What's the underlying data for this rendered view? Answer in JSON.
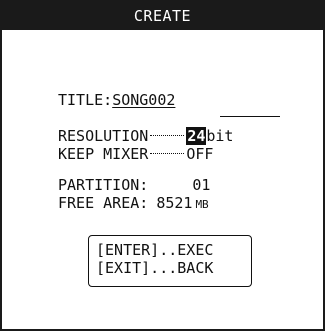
{
  "window": {
    "title": "CREATE"
  },
  "form": {
    "title_label": "TITLE:",
    "title_value": "SONG002",
    "resolution_label": "RESOLUTION",
    "resolution_value": "24",
    "resolution_unit": "bit",
    "keep_mixer_label": "KEEP MIXER",
    "keep_mixer_value": "OFF",
    "partition_label": "PARTITION:",
    "partition_value": "01",
    "free_area_label": "FREE AREA:",
    "free_area_value": "8521",
    "free_area_unit": "MB"
  },
  "keys": {
    "enter_line": "[ENTER]..EXEC",
    "exit_line": "[EXIT]...BACK"
  }
}
